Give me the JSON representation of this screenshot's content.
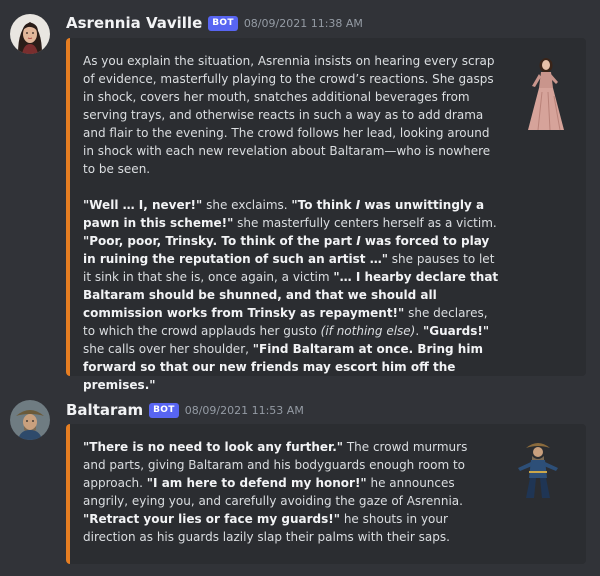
{
  "messages": [
    {
      "username": "Asrennia Vaville",
      "badge": "BOT",
      "timestamp": "08/09/2021 11:38 AM",
      "accent": "#e67e22",
      "paragraphs": [
        [
          {
            "t": "As you explain the situation, Asrennia insists on hearing every scrap of evidence, masterfully playing to the crowd’s reactions. She gasps in shock, covers her mouth, snatches additional beverages from serving trays, and otherwise reacts in such a way as to add drama and flair to the evening. The crowd follows her lead, looking around in shock with each new revelation about Baltaram—who is nowhere to be seen."
          }
        ],
        [
          {
            "t": "\"Well … I, never!\"",
            "b": true
          },
          {
            "t": " she exclaims. "
          },
          {
            "t": "\"To think ",
            "b": true
          },
          {
            "t": "I",
            "b": true,
            "i": true
          },
          {
            "t": " was unwittingly a pawn in this scheme!\"",
            "b": true
          },
          {
            "t": " she masterfully centers herself as a victim. "
          },
          {
            "t": "\"Poor, poor, Trinsky. To think of the part ",
            "b": true
          },
          {
            "t": "I",
            "b": true,
            "i": true
          },
          {
            "t": " was forced to play in ruining the reputation of such an artist …\"",
            "b": true
          },
          {
            "t": " she pauses to let it sink in that she is, once again, a victim "
          },
          {
            "t": "\"… I hearby declare that Baltaram should be shunned, and that we should all commission works from Trinsky as repayment!\"",
            "b": true
          },
          {
            "t": " she declares, to which the crowd applauds her gusto "
          },
          {
            "t": "(if nothing else)",
            "i": true
          },
          {
            "t": ". "
          },
          {
            "t": "\"Guards!\"",
            "b": true
          },
          {
            "t": " she calls over her shoulder, "
          },
          {
            "t": "\"Find Baltaram at once. Bring him forward so that our new friends may escort him off the premises.\"",
            "b": true
          }
        ]
      ]
    },
    {
      "username": "Baltaram",
      "badge": "BOT",
      "timestamp": "08/09/2021 11:53 AM",
      "accent": "#e67e22",
      "paragraphs": [
        [
          {
            "t": "\"There is no need to look any further.\"",
            "b": true
          },
          {
            "t": " The crowd murmurs and parts, giving Baltaram and his bodyguards enough room to approach. "
          },
          {
            "t": "\"I am here to defend my honor!\"",
            "b": true
          },
          {
            "t": " he announces angrily, eying you, and carefully avoiding the gaze of Asrennia. "
          },
          {
            "t": "\"Retract your lies or face my guards!\"",
            "b": true
          },
          {
            "t": " he shouts in your direction as his guards lazily slap their palms with their saps."
          }
        ]
      ]
    }
  ]
}
